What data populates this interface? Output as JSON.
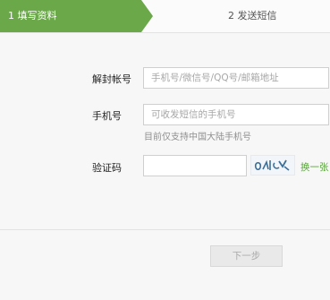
{
  "steps": [
    {
      "label": "1 填写资料"
    },
    {
      "label": "2 发送短信"
    }
  ],
  "form": {
    "account": {
      "label": "解封帐号",
      "placeholder": "手机号/微信号/QQ号/邮箱地址"
    },
    "phone": {
      "label": "手机号",
      "placeholder": "可收发短信的手机号",
      "hint": "目前仅支持中国大陆手机号"
    },
    "captcha": {
      "label": "验证码",
      "value": "",
      "refresh_label": "换一张"
    }
  },
  "actions": {
    "next_label": "下一步"
  },
  "colors": {
    "accent_green": "#6aa84a",
    "link_green": "#58a33b"
  }
}
